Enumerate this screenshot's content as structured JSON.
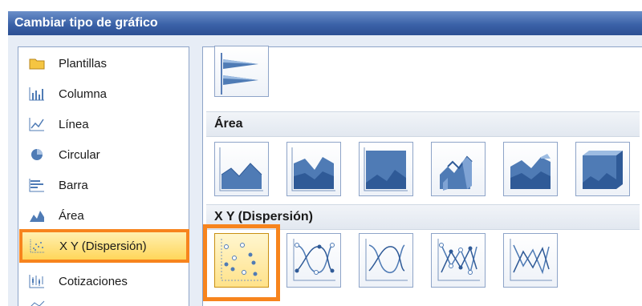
{
  "dialog": {
    "title": "Cambiar tipo de gráfico"
  },
  "categories": [
    {
      "label": "Plantillas",
      "icon": "folder-icon"
    },
    {
      "label": "Columna",
      "icon": "column-chart-icon"
    },
    {
      "label": "Línea",
      "icon": "line-chart-icon"
    },
    {
      "label": "Circular",
      "icon": "pie-chart-icon"
    },
    {
      "label": "Barra",
      "icon": "bar-chart-icon"
    },
    {
      "label": "Área",
      "icon": "area-chart-icon"
    },
    {
      "label": "X Y (Dispersión)",
      "icon": "scatter-chart-icon",
      "selected": true
    },
    {
      "label": "Cotizaciones",
      "icon": "stock-chart-icon"
    },
    {
      "label": "",
      "icon": "surface-chart-icon"
    }
  ],
  "gallery": {
    "sections": [
      {
        "title": "Área"
      },
      {
        "title": "X Y (Dispersión)"
      }
    ]
  },
  "colors": {
    "accent_orange": "#f7841d",
    "title_bar": "#3b62a8",
    "chart_blue": "#4f7bb5"
  }
}
